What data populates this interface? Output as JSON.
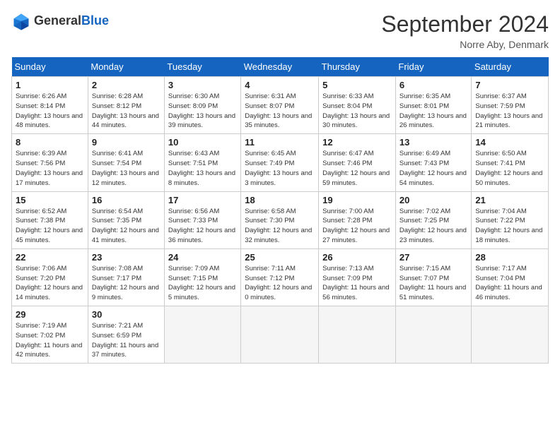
{
  "header": {
    "logo_general": "General",
    "logo_blue": "Blue",
    "month_title": "September 2024",
    "location": "Norre Aby, Denmark"
  },
  "days_of_week": [
    "Sunday",
    "Monday",
    "Tuesday",
    "Wednesday",
    "Thursday",
    "Friday",
    "Saturday"
  ],
  "weeks": [
    [
      {
        "day": "1",
        "sunrise": "Sunrise: 6:26 AM",
        "sunset": "Sunset: 8:14 PM",
        "daylight": "Daylight: 13 hours and 48 minutes."
      },
      {
        "day": "2",
        "sunrise": "Sunrise: 6:28 AM",
        "sunset": "Sunset: 8:12 PM",
        "daylight": "Daylight: 13 hours and 44 minutes."
      },
      {
        "day": "3",
        "sunrise": "Sunrise: 6:30 AM",
        "sunset": "Sunset: 8:09 PM",
        "daylight": "Daylight: 13 hours and 39 minutes."
      },
      {
        "day": "4",
        "sunrise": "Sunrise: 6:31 AM",
        "sunset": "Sunset: 8:07 PM",
        "daylight": "Daylight: 13 hours and 35 minutes."
      },
      {
        "day": "5",
        "sunrise": "Sunrise: 6:33 AM",
        "sunset": "Sunset: 8:04 PM",
        "daylight": "Daylight: 13 hours and 30 minutes."
      },
      {
        "day": "6",
        "sunrise": "Sunrise: 6:35 AM",
        "sunset": "Sunset: 8:01 PM",
        "daylight": "Daylight: 13 hours and 26 minutes."
      },
      {
        "day": "7",
        "sunrise": "Sunrise: 6:37 AM",
        "sunset": "Sunset: 7:59 PM",
        "daylight": "Daylight: 13 hours and 21 minutes."
      }
    ],
    [
      {
        "day": "8",
        "sunrise": "Sunrise: 6:39 AM",
        "sunset": "Sunset: 7:56 PM",
        "daylight": "Daylight: 13 hours and 17 minutes."
      },
      {
        "day": "9",
        "sunrise": "Sunrise: 6:41 AM",
        "sunset": "Sunset: 7:54 PM",
        "daylight": "Daylight: 13 hours and 12 minutes."
      },
      {
        "day": "10",
        "sunrise": "Sunrise: 6:43 AM",
        "sunset": "Sunset: 7:51 PM",
        "daylight": "Daylight: 13 hours and 8 minutes."
      },
      {
        "day": "11",
        "sunrise": "Sunrise: 6:45 AM",
        "sunset": "Sunset: 7:49 PM",
        "daylight": "Daylight: 13 hours and 3 minutes."
      },
      {
        "day": "12",
        "sunrise": "Sunrise: 6:47 AM",
        "sunset": "Sunset: 7:46 PM",
        "daylight": "Daylight: 12 hours and 59 minutes."
      },
      {
        "day": "13",
        "sunrise": "Sunrise: 6:49 AM",
        "sunset": "Sunset: 7:43 PM",
        "daylight": "Daylight: 12 hours and 54 minutes."
      },
      {
        "day": "14",
        "sunrise": "Sunrise: 6:50 AM",
        "sunset": "Sunset: 7:41 PM",
        "daylight": "Daylight: 12 hours and 50 minutes."
      }
    ],
    [
      {
        "day": "15",
        "sunrise": "Sunrise: 6:52 AM",
        "sunset": "Sunset: 7:38 PM",
        "daylight": "Daylight: 12 hours and 45 minutes."
      },
      {
        "day": "16",
        "sunrise": "Sunrise: 6:54 AM",
        "sunset": "Sunset: 7:35 PM",
        "daylight": "Daylight: 12 hours and 41 minutes."
      },
      {
        "day": "17",
        "sunrise": "Sunrise: 6:56 AM",
        "sunset": "Sunset: 7:33 PM",
        "daylight": "Daylight: 12 hours and 36 minutes."
      },
      {
        "day": "18",
        "sunrise": "Sunrise: 6:58 AM",
        "sunset": "Sunset: 7:30 PM",
        "daylight": "Daylight: 12 hours and 32 minutes."
      },
      {
        "day": "19",
        "sunrise": "Sunrise: 7:00 AM",
        "sunset": "Sunset: 7:28 PM",
        "daylight": "Daylight: 12 hours and 27 minutes."
      },
      {
        "day": "20",
        "sunrise": "Sunrise: 7:02 AM",
        "sunset": "Sunset: 7:25 PM",
        "daylight": "Daylight: 12 hours and 23 minutes."
      },
      {
        "day": "21",
        "sunrise": "Sunrise: 7:04 AM",
        "sunset": "Sunset: 7:22 PM",
        "daylight": "Daylight: 12 hours and 18 minutes."
      }
    ],
    [
      {
        "day": "22",
        "sunrise": "Sunrise: 7:06 AM",
        "sunset": "Sunset: 7:20 PM",
        "daylight": "Daylight: 12 hours and 14 minutes."
      },
      {
        "day": "23",
        "sunrise": "Sunrise: 7:08 AM",
        "sunset": "Sunset: 7:17 PM",
        "daylight": "Daylight: 12 hours and 9 minutes."
      },
      {
        "day": "24",
        "sunrise": "Sunrise: 7:09 AM",
        "sunset": "Sunset: 7:15 PM",
        "daylight": "Daylight: 12 hours and 5 minutes."
      },
      {
        "day": "25",
        "sunrise": "Sunrise: 7:11 AM",
        "sunset": "Sunset: 7:12 PM",
        "daylight": "Daylight: 12 hours and 0 minutes."
      },
      {
        "day": "26",
        "sunrise": "Sunrise: 7:13 AM",
        "sunset": "Sunset: 7:09 PM",
        "daylight": "Daylight: 11 hours and 56 minutes."
      },
      {
        "day": "27",
        "sunrise": "Sunrise: 7:15 AM",
        "sunset": "Sunset: 7:07 PM",
        "daylight": "Daylight: 11 hours and 51 minutes."
      },
      {
        "day": "28",
        "sunrise": "Sunrise: 7:17 AM",
        "sunset": "Sunset: 7:04 PM",
        "daylight": "Daylight: 11 hours and 46 minutes."
      }
    ],
    [
      {
        "day": "29",
        "sunrise": "Sunrise: 7:19 AM",
        "sunset": "Sunset: 7:02 PM",
        "daylight": "Daylight: 11 hours and 42 minutes."
      },
      {
        "day": "30",
        "sunrise": "Sunrise: 7:21 AM",
        "sunset": "Sunset: 6:59 PM",
        "daylight": "Daylight: 11 hours and 37 minutes."
      },
      null,
      null,
      null,
      null,
      null
    ]
  ]
}
